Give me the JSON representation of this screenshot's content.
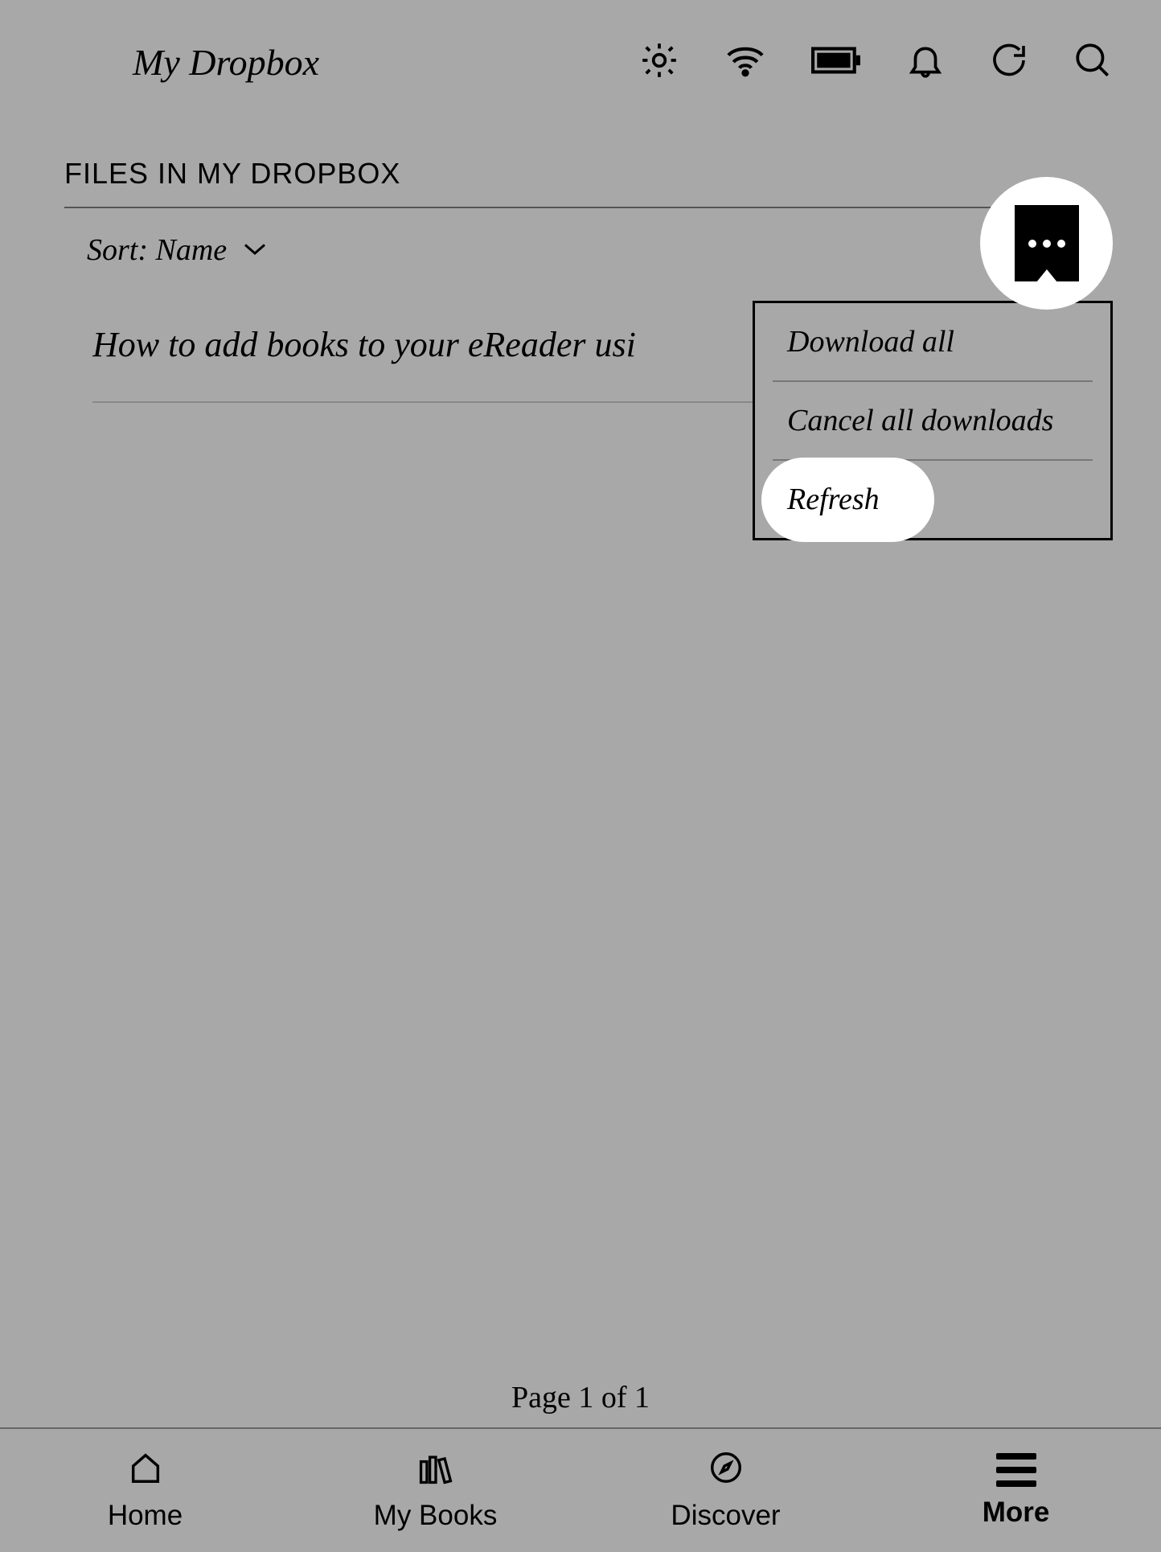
{
  "header": {
    "title": "My Dropbox"
  },
  "section": {
    "title": "FILES IN MY DROPBOX",
    "sort_label": "Sort: Name"
  },
  "files": [
    {
      "name": "How to add books to your eReader usi"
    }
  ],
  "dropdown": {
    "download_all": "Download all",
    "cancel_all": "Cancel all downloads",
    "refresh": "Refresh"
  },
  "pagination": {
    "label": "Page 1 of 1"
  },
  "nav": {
    "home": "Home",
    "my_books": "My Books",
    "discover": "Discover",
    "more": "More"
  }
}
